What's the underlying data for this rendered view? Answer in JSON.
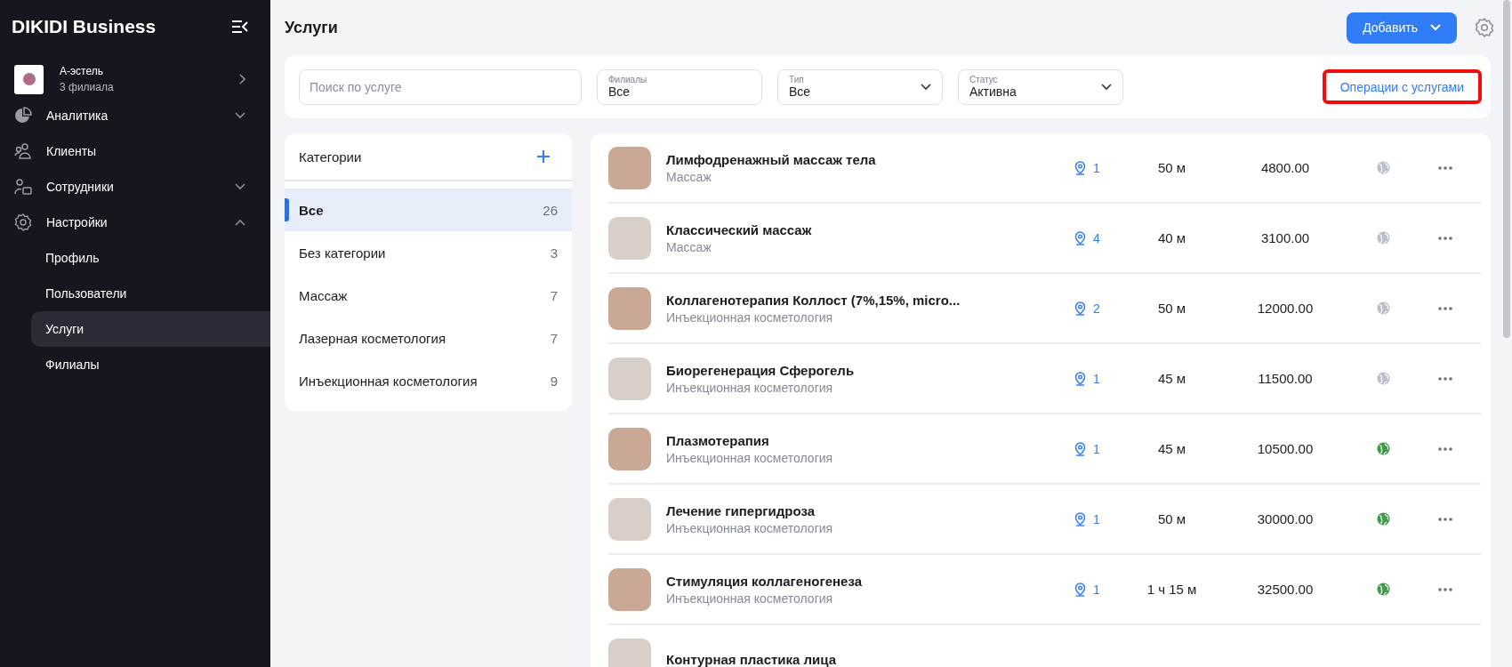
{
  "sidebar": {
    "title": "DIKIDI Business",
    "account": {
      "name": "А-эстель",
      "subtitle": "3 филиала"
    },
    "items": [
      {
        "label": "Аналитика",
        "expanded": false
      },
      {
        "label": "Клиенты"
      },
      {
        "label": "Сотрудники",
        "expanded": false
      },
      {
        "label": "Настройки",
        "expanded": true,
        "children": [
          {
            "label": "Профиль",
            "selected": false
          },
          {
            "label": "Пользователи",
            "selected": false
          },
          {
            "label": "Услуги",
            "selected": true
          },
          {
            "label": "Филиалы",
            "selected": false
          }
        ]
      }
    ]
  },
  "header": {
    "title": "Услуги",
    "add_button": "Добавить"
  },
  "filters": {
    "search": {
      "placeholder": "Поиск по услуге"
    },
    "selects": [
      {
        "kind": "field",
        "label": "Филиалы",
        "value": "Все"
      },
      {
        "kind": "select",
        "label": "Тип",
        "value": "Все"
      },
      {
        "kind": "select",
        "label": "Статус",
        "value": "Активна"
      }
    ],
    "operations_button": {
      "label": "Операции с услугами",
      "highlighted": true
    }
  },
  "categories": {
    "title": "Категории",
    "items": [
      {
        "name": "Все",
        "count": "26",
        "selected": true
      },
      {
        "name": "Без категории",
        "count": "3",
        "selected": false
      },
      {
        "name": "Массаж",
        "count": "7",
        "selected": false
      },
      {
        "name": "Лазерная косметология",
        "count": "7",
        "selected": false
      },
      {
        "name": "Инъекционная косметология",
        "count": "9",
        "selected": false
      }
    ]
  },
  "services": [
    {
      "name": "Лимфодренажный массаж тела",
      "category": "Массаж",
      "branches": "1",
      "duration": "50 м",
      "price": "4800.00",
      "online": false
    },
    {
      "name": "Классический массаж",
      "category": "Массаж",
      "branches": "4",
      "duration": "40 м",
      "price": "3100.00",
      "online": false
    },
    {
      "name": "Коллагенотерапия Коллост (7%,15%, micro...",
      "category": "Инъекционная косметология",
      "branches": "2",
      "duration": "50 м",
      "price": "12000.00",
      "online": false
    },
    {
      "name": "Биорегенерация Сферогель",
      "category": "Инъекционная косметология",
      "branches": "1",
      "duration": "45 м",
      "price": "11500.00",
      "online": false
    },
    {
      "name": "Плазмотерапия",
      "category": "Инъекционная косметология",
      "branches": "1",
      "duration": "45 м",
      "price": "10500.00",
      "online": true
    },
    {
      "name": "Лечение гипергидроза",
      "category": "Инъекционная косметология",
      "branches": "1",
      "duration": "50 м",
      "price": "30000.00",
      "online": true
    },
    {
      "name": "Стимуляция коллагеногенеза",
      "category": "Инъекционная косметология",
      "branches": "1",
      "duration": "1 ч 15 м",
      "price": "32500.00",
      "online": true
    },
    {
      "name": "Контурная пластика лица"
    }
  ]
}
